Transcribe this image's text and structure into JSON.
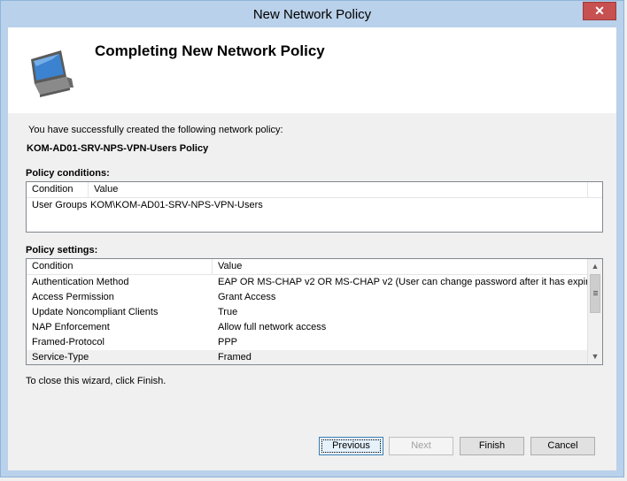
{
  "window": {
    "title": "New Network Policy",
    "close_label": "✕"
  },
  "header": {
    "title": "Completing New Network Policy",
    "icon": "computer-monitor-icon"
  },
  "intro_text": "You have successfully created the following network policy:",
  "policy_name": "KOM-AD01-SRV-NPS-VPN-Users Policy",
  "conditions": {
    "label": "Policy conditions:",
    "columns": [
      "Condition",
      "Value"
    ],
    "rows": [
      {
        "condition": "User Groups",
        "value": "KOM\\KOM-AD01-SRV-NPS-VPN-Users"
      }
    ]
  },
  "settings": {
    "label": "Policy settings:",
    "columns": [
      "Condition",
      "Value"
    ],
    "rows": [
      {
        "condition": "Authentication Method",
        "value": "EAP OR MS-CHAP v2 OR MS-CHAP v2 (User can change password after it has expir..."
      },
      {
        "condition": "Access Permission",
        "value": "Grant Access"
      },
      {
        "condition": "Update Noncompliant Clients",
        "value": "True"
      },
      {
        "condition": "NAP Enforcement",
        "value": "Allow full network access"
      },
      {
        "condition": "Framed-Protocol",
        "value": "PPP"
      },
      {
        "condition": "Service-Type",
        "value": "Framed"
      }
    ]
  },
  "footer_text": "To close this wizard, click Finish.",
  "buttons": {
    "previous": "Previous",
    "next": "Next",
    "finish": "Finish",
    "cancel": "Cancel"
  }
}
